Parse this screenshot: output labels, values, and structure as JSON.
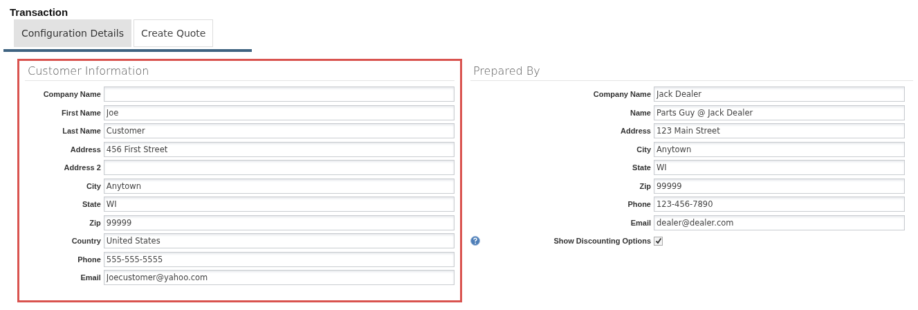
{
  "page_title": "Transaction",
  "tabs": [
    {
      "label": "Configuration Details",
      "selected": true
    },
    {
      "label": "Create Quote",
      "selected": false
    }
  ],
  "customer_information": {
    "title": "Customer Information",
    "highlighted": true,
    "fields": [
      {
        "label": "Company Name"
      },
      {
        "label": "First Name",
        "value": "Joe"
      },
      {
        "label": "Last Name",
        "value": "Customer"
      },
      {
        "label": "Address",
        "value": "456 First Street"
      },
      {
        "label": "Address 2"
      },
      {
        "label": "City",
        "value": "Anytown"
      },
      {
        "label": "State",
        "value": "WI"
      },
      {
        "label": "Zip",
        "value": "99999"
      },
      {
        "label": "Country",
        "value": "United States"
      },
      {
        "label": "Phone",
        "value": "555-555-5555"
      },
      {
        "label": "Email",
        "value": "Joecustomer@yahoo.com"
      }
    ]
  },
  "prepared_by": {
    "title": "Prepared By",
    "fields": [
      {
        "kind": "text",
        "label": "Company Name",
        "value": "Jack Dealer"
      },
      {
        "kind": "text",
        "label": "Name",
        "value": "Parts Guy @ Jack Dealer"
      },
      {
        "kind": "text",
        "label": "Address",
        "value": "123 Main Street"
      },
      {
        "kind": "text",
        "label": "City",
        "value": "Anytown"
      },
      {
        "kind": "text",
        "label": "State",
        "value": "WI"
      },
      {
        "kind": "text",
        "label": "Zip",
        "value": "99999"
      },
      {
        "kind": "text",
        "label": "Phone",
        "value": "123-456-7890"
      },
      {
        "kind": "text",
        "label": "Email",
        "value": "dealer@dealer.com"
      },
      {
        "kind": "checkbox",
        "label": "Show Discounting Options",
        "checked": true,
        "help": true
      }
    ]
  }
}
